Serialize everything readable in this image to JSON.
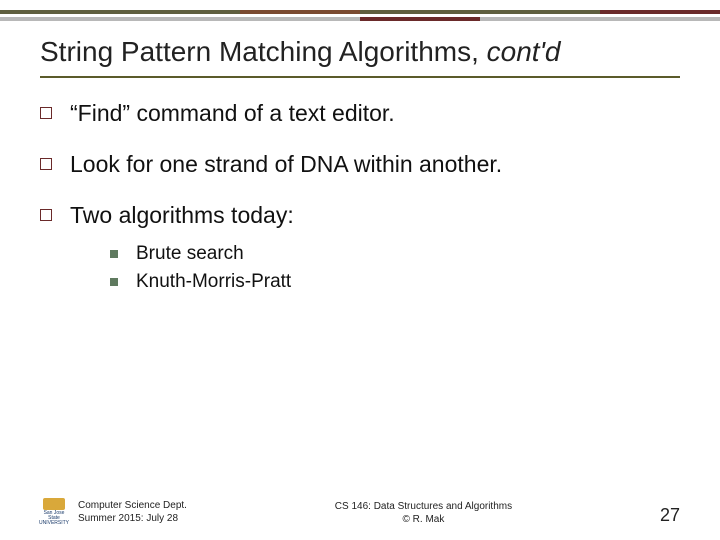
{
  "title_main": "String Pattern Matching Algorithms, ",
  "title_italic": "cont'd",
  "bullets": [
    "“Find” command of a text editor.",
    "Look for one strand of DNA within another.",
    "Two algorithms today:"
  ],
  "sub_bullets": [
    "Brute search",
    "Knuth-Morris-Pratt"
  ],
  "footer": {
    "dept": "Computer Science Dept.",
    "term": "Summer 2015: July 28",
    "course": "CS 146: Data Structures and Algorithms",
    "author": "© R. Mak",
    "page": "27",
    "logo_text": "San Jose State UNIVERSITY"
  }
}
